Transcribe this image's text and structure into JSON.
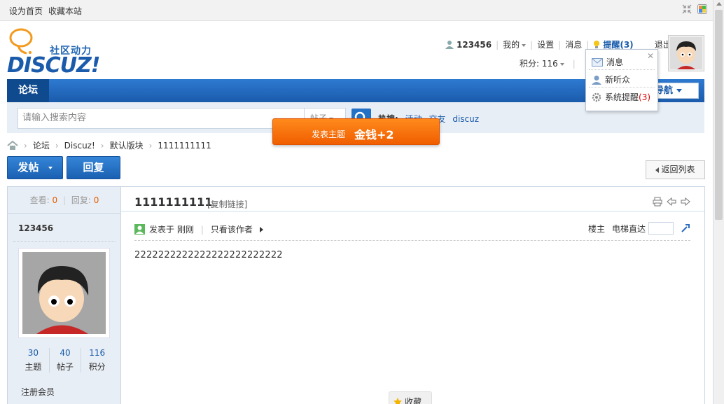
{
  "topbar": {
    "set_home": "设为首页",
    "bookmark": "收藏本站"
  },
  "logo": {
    "tagline": "社区动力",
    "wordmark": "DISCUZ!"
  },
  "userbar": {
    "username": "123456",
    "my": "我的",
    "settings": "设置",
    "messages": "消息",
    "reminder": "提醒(3)",
    "logout": "退出",
    "points": "积分: 116"
  },
  "popup": {
    "items": [
      {
        "label": "消息"
      },
      {
        "label": "新听众"
      },
      {
        "label": "系统提醒",
        "count": "(3)"
      }
    ]
  },
  "nav": {
    "forum": "论坛",
    "quick_nav": "导航"
  },
  "search": {
    "placeholder": "请输入搜索内容",
    "type": "帖子",
    "hot_label": "热搜:",
    "hot_items": [
      "活动",
      "交友",
      "discuz"
    ]
  },
  "toast": {
    "action": "发表主题",
    "reward": "金钱+2"
  },
  "breadcrumb": [
    "论坛",
    "Discuz!",
    "默认版块",
    "1111111111"
  ],
  "buttons": {
    "post": "发帖",
    "reply": "回复",
    "back": "返回列表"
  },
  "thread": {
    "views_label": "查看:",
    "views": "0",
    "replies_label": "回复:",
    "replies": "0",
    "title": "1111111111",
    "copy_link": "[复制链接]",
    "author": "123456",
    "posted": "发表于 刚刚",
    "only_author": "只看该作者",
    "floor": "楼主",
    "jump": "电梯直达",
    "content": "2222222222222222222222222",
    "favorite": "收藏"
  },
  "profile": {
    "stats": [
      {
        "value": "30",
        "label": "主题"
      },
      {
        "value": "40",
        "label": "帖子"
      },
      {
        "value": "116",
        "label": "积分"
      }
    ],
    "rank": "注册会员"
  }
}
